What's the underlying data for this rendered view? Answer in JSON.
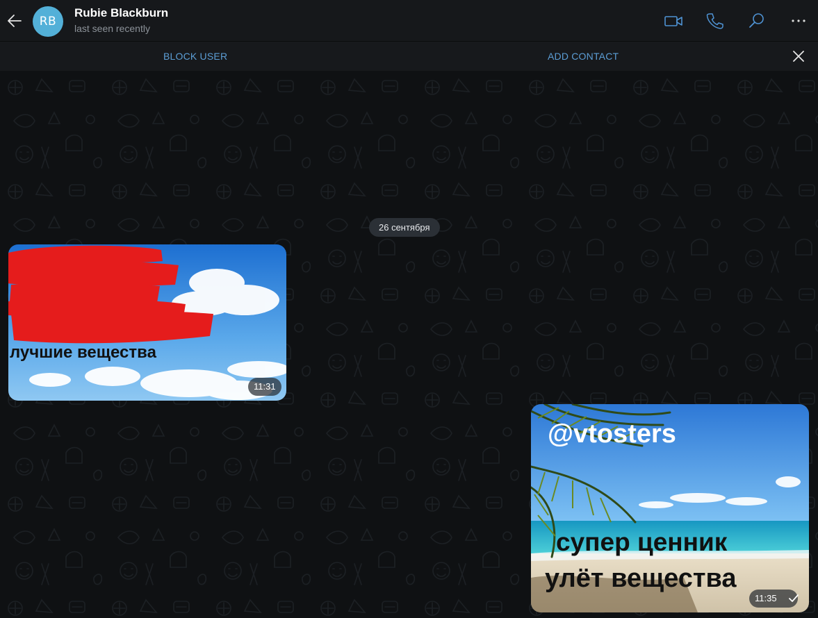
{
  "header": {
    "avatar_initials": "RB",
    "name": "Rubie Blackburn",
    "status": "last seen recently"
  },
  "actions": {
    "block_user": "BLOCK USER",
    "add_contact": "ADD CONTACT"
  },
  "chat": {
    "date_separator": "26 сентября",
    "messages": [
      {
        "direction": "incoming",
        "type": "photo",
        "image_text": "лучшие вещества",
        "time": "11:31",
        "redacted": true
      },
      {
        "direction": "outgoing",
        "type": "photo",
        "image_text": [
          "@vtosters",
          "супер ценник",
          "улёт вещества"
        ],
        "time": "11:35",
        "read_state": "check-icon"
      }
    ]
  },
  "colors": {
    "header_bg": "#16181b",
    "chat_bg": "#0f1113",
    "accent": "#5c9ed6",
    "avatar": "#53b0d8",
    "redaction": "#e51c1c"
  }
}
